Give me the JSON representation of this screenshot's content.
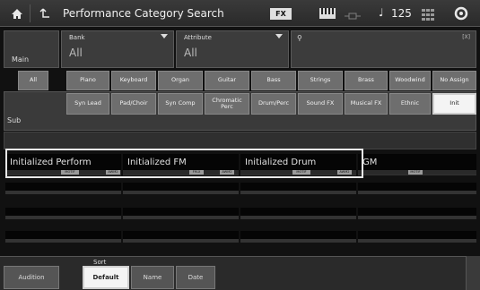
{
  "topbar": {
    "title": "Performance Category Search",
    "fx": "FX",
    "tempo_note": "♩",
    "tempo": "125",
    "icons": [
      "home-icon",
      "back-icon",
      "keyboard-icon",
      "midi-icon",
      "grid-icon",
      "gear-icon"
    ]
  },
  "main": {
    "label": "Main",
    "bank_label": "Bank",
    "bank_value": "All",
    "attribute_label": "Attribute",
    "attribute_value": "All",
    "search_value": "",
    "clear_label": "[X]",
    "categories": [
      "All",
      "Piano",
      "Keyboard",
      "Organ",
      "Guitar",
      "Bass",
      "Strings",
      "Brass",
      "Woodwind",
      "No Assign"
    ]
  },
  "sub": {
    "label": "Sub",
    "categories": [
      "Syn Lead",
      "Pad/Choir",
      "Syn Comp",
      "Chromatic Perc",
      "Drum/Perc",
      "Sound FX",
      "Musical FX",
      "Ethnic",
      "Init"
    ],
    "selected": "Init"
  },
  "results": {
    "items": [
      {
        "name": "Initialized Perform",
        "tags": [
          "MOTIF",
          "AWM2"
        ]
      },
      {
        "name": "Initialized FM",
        "tags": [
          "FM-X",
          "AWM2"
        ]
      },
      {
        "name": "Initialized Drum",
        "tags": [
          "MOTIF",
          "AWM2"
        ]
      },
      {
        "name": "GM",
        "tags": [
          "MOTIF"
        ]
      }
    ]
  },
  "bottom": {
    "audition": "Audition",
    "sort_label": "Sort",
    "sort_options": [
      "Default",
      "Name",
      "Date"
    ],
    "sort_selected": "Default"
  },
  "colors": {
    "selected": "#f4f4f4",
    "button": "#6e6e6e",
    "background": "#111111"
  }
}
